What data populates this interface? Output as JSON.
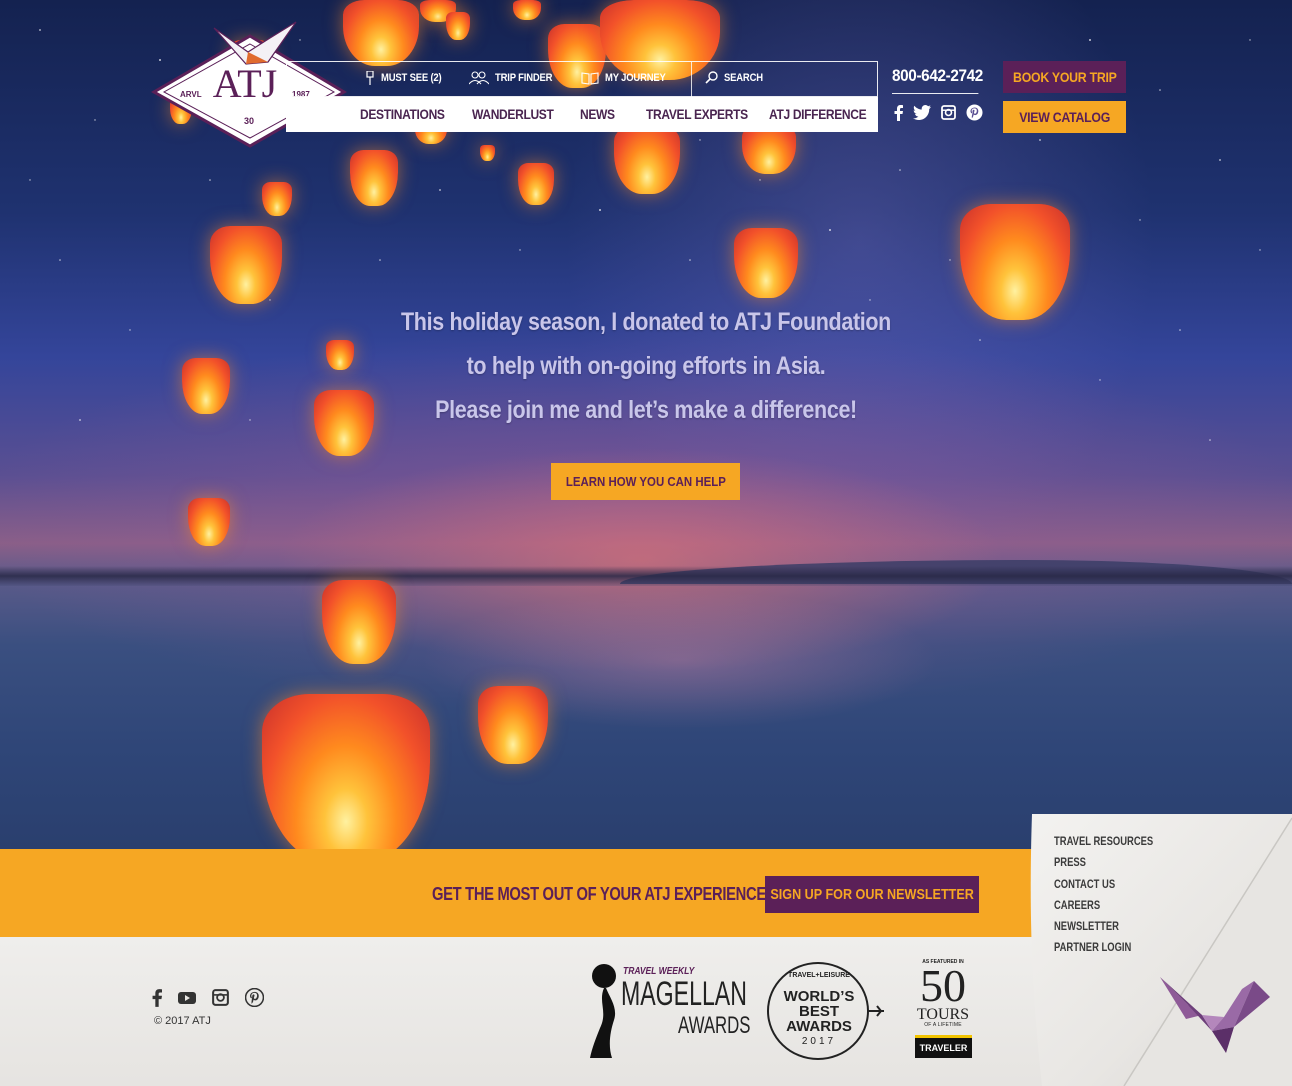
{
  "brand": {
    "logo_text": "ATJ",
    "logo_left": "ARVL",
    "logo_right": "1987",
    "logo_badge": "30"
  },
  "utility_nav": {
    "must_see": "MUST SEE (2)",
    "trip_finder": "TRIP FINDER",
    "my_journey": "MY JOURNEY",
    "search_placeholder": "SEARCH"
  },
  "main_nav": {
    "items": [
      {
        "label": "DESTINATIONS"
      },
      {
        "label": "WANDERLUST"
      },
      {
        "label": "NEWS"
      },
      {
        "label": "TRAVEL EXPERTS"
      },
      {
        "label": "ATJ DIFFERENCE"
      }
    ]
  },
  "header": {
    "phone": "800-642-2742",
    "book_trip": "BOOK YOUR TRIP",
    "view_catalog": "VIEW CATALOG"
  },
  "hero": {
    "line1": "This holiday season, I donated to ATJ Foundation",
    "line2": "to help with on-going efforts in Asia.",
    "line3": "Please join me and let’s make a difference!",
    "cta": "LEARN HOW YOU CAN HELP"
  },
  "newsletter": {
    "text": "GET THE MOST OUT OF YOUR ATJ EXPERIENCE",
    "button": "SIGN UP FOR OUR NEWSLETTER"
  },
  "footer": {
    "copyright": "© 2017 ATJ",
    "links": [
      {
        "label": "TRAVEL RESOURCES"
      },
      {
        "label": "PRESS"
      },
      {
        "label": "CONTACT US"
      },
      {
        "label": "CAREERS"
      },
      {
        "label": "NEWSLETTER"
      },
      {
        "label": "PARTNER LOGIN"
      }
    ]
  },
  "awards": {
    "magellan_top": "TRAVEL WEEKLY",
    "magellan_main": "MAGELLAN",
    "magellan_sub": "AWARDS",
    "worlds_best_top": "TRAVEL+LEISURE",
    "worlds_best_line1": "WORLD’S",
    "worlds_best_line2": "BEST",
    "worlds_best_line3": "AWARDS",
    "worlds_best_year": "2017",
    "ng_top": "AS FEATURED IN",
    "ng_number": "50",
    "ng_tours": "TOURS",
    "ng_life": "OF A LIFETIME",
    "ng_badge": "TRAVELER"
  },
  "colors": {
    "brand_purple": "#5b2058",
    "brand_orange": "#f6a723"
  }
}
